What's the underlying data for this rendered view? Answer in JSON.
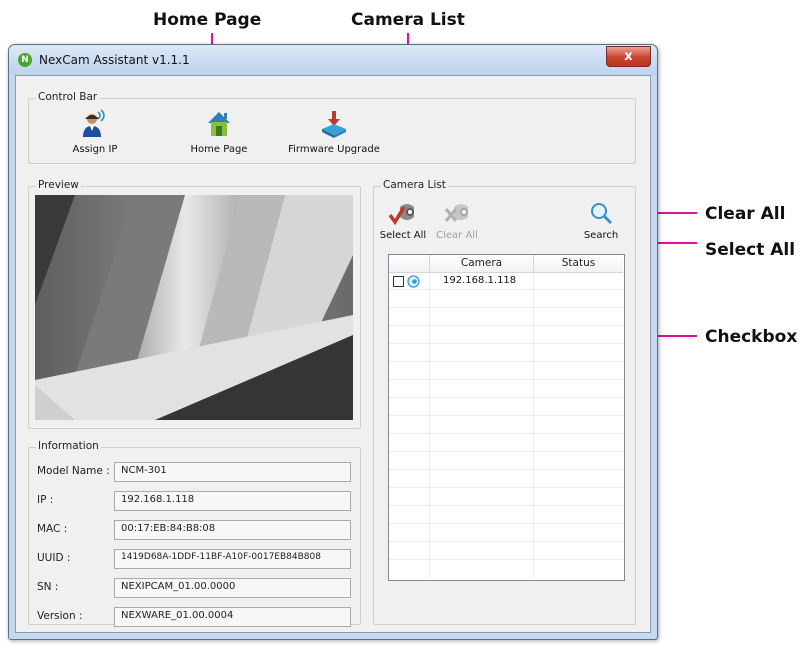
{
  "callouts": {
    "home_page": "Home Page",
    "camera_list": "Camera List",
    "clear_all": "Clear All",
    "select_all": "Select All",
    "checkbox": "Checkbox"
  },
  "window": {
    "title": "NexCam Assistant v1.1.1",
    "close_glyph": "x",
    "app_icon_letter": "N"
  },
  "control_bar": {
    "title": "Control Bar",
    "assign_ip": "Assign IP",
    "home_page": "Home Page",
    "firmware_upgrade": "Firmware Upgrade"
  },
  "preview": {
    "title": "Preview"
  },
  "information": {
    "title": "Information",
    "model_name_label": "Model Name :",
    "model_name": "NCM-301",
    "ip_label": "IP :",
    "ip": "192.168.1.118",
    "mac_label": "MAC :",
    "mac": "00:17:EB:84:B8:08",
    "uuid_label": "UUID :",
    "uuid": "1419D68A-1DDF-11BF-A10F-0017EB84B808",
    "sn_label": "SN :",
    "sn": "NEXIPCAM_01.00.0000",
    "version_label": "Version :",
    "version": "NEXWARE_01.00.0004"
  },
  "camera_list": {
    "title": "Camera List",
    "select_all": "Select All",
    "clear_all": "Clear All",
    "search": "Search",
    "columns": [
      "",
      "Camera",
      "Status"
    ],
    "rows": [
      {
        "checked": false,
        "camera": "192.168.1.118",
        "status": ""
      }
    ]
  },
  "colors": {
    "callout_line": "#e0119a",
    "close_button": "#c9452e",
    "window_frame": "#c5d8ee"
  }
}
